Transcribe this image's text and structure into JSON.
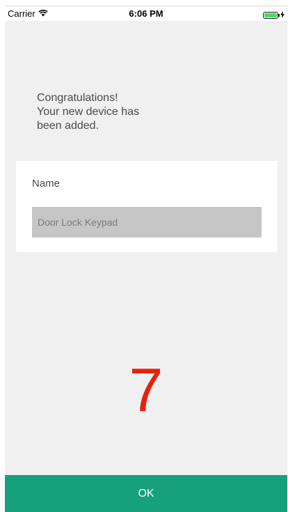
{
  "status_bar": {
    "carrier": "Carrier",
    "time": "6:06 PM",
    "wifi_icon": "wifi-icon",
    "battery_icon": "battery-icon",
    "charging_icon": "charging-bolt-icon",
    "battery_level": 1.0
  },
  "message": {
    "lines": [
      "Congratulations!",
      "Your new device has",
      "been added."
    ]
  },
  "form": {
    "name_label": "Name",
    "name_placeholder": "Door Lock Keypad",
    "name_value": ""
  },
  "annotation": {
    "number": "7",
    "color": "#e8200c"
  },
  "footer": {
    "ok_label": "OK",
    "button_color": "#17a07c"
  }
}
